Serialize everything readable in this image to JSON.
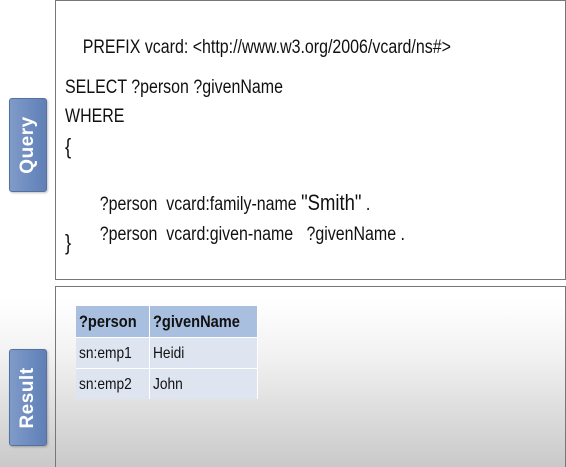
{
  "tabs": {
    "query_label": "Query",
    "result_label": "Result"
  },
  "query": {
    "prefix_line": "PREFIX vcard: <http://www.w3.org/2006/vcard/ns#>",
    "select_line": "SELECT ?person ?givenName",
    "where_line": "WHERE",
    "open_brace": "{",
    "pattern1": {
      "subject": "?person",
      "predicate": "vcard:family-name",
      "object": "\"Smith\"",
      "end": "."
    },
    "pattern2": {
      "subject": "?person",
      "predicate": "vcard:given-name",
      "object": "?givenName",
      "end": "."
    },
    "close_brace": "}"
  },
  "result": {
    "columns": [
      "?person",
      "?givenName"
    ],
    "rows": [
      [
        "sn:emp1",
        "Heidi"
      ],
      [
        "sn:emp2",
        "John"
      ]
    ]
  },
  "colors": {
    "tab_blue": "#6f8dc0",
    "header_blue": "#a9bfdf",
    "row_blue": "#dee5f1"
  }
}
